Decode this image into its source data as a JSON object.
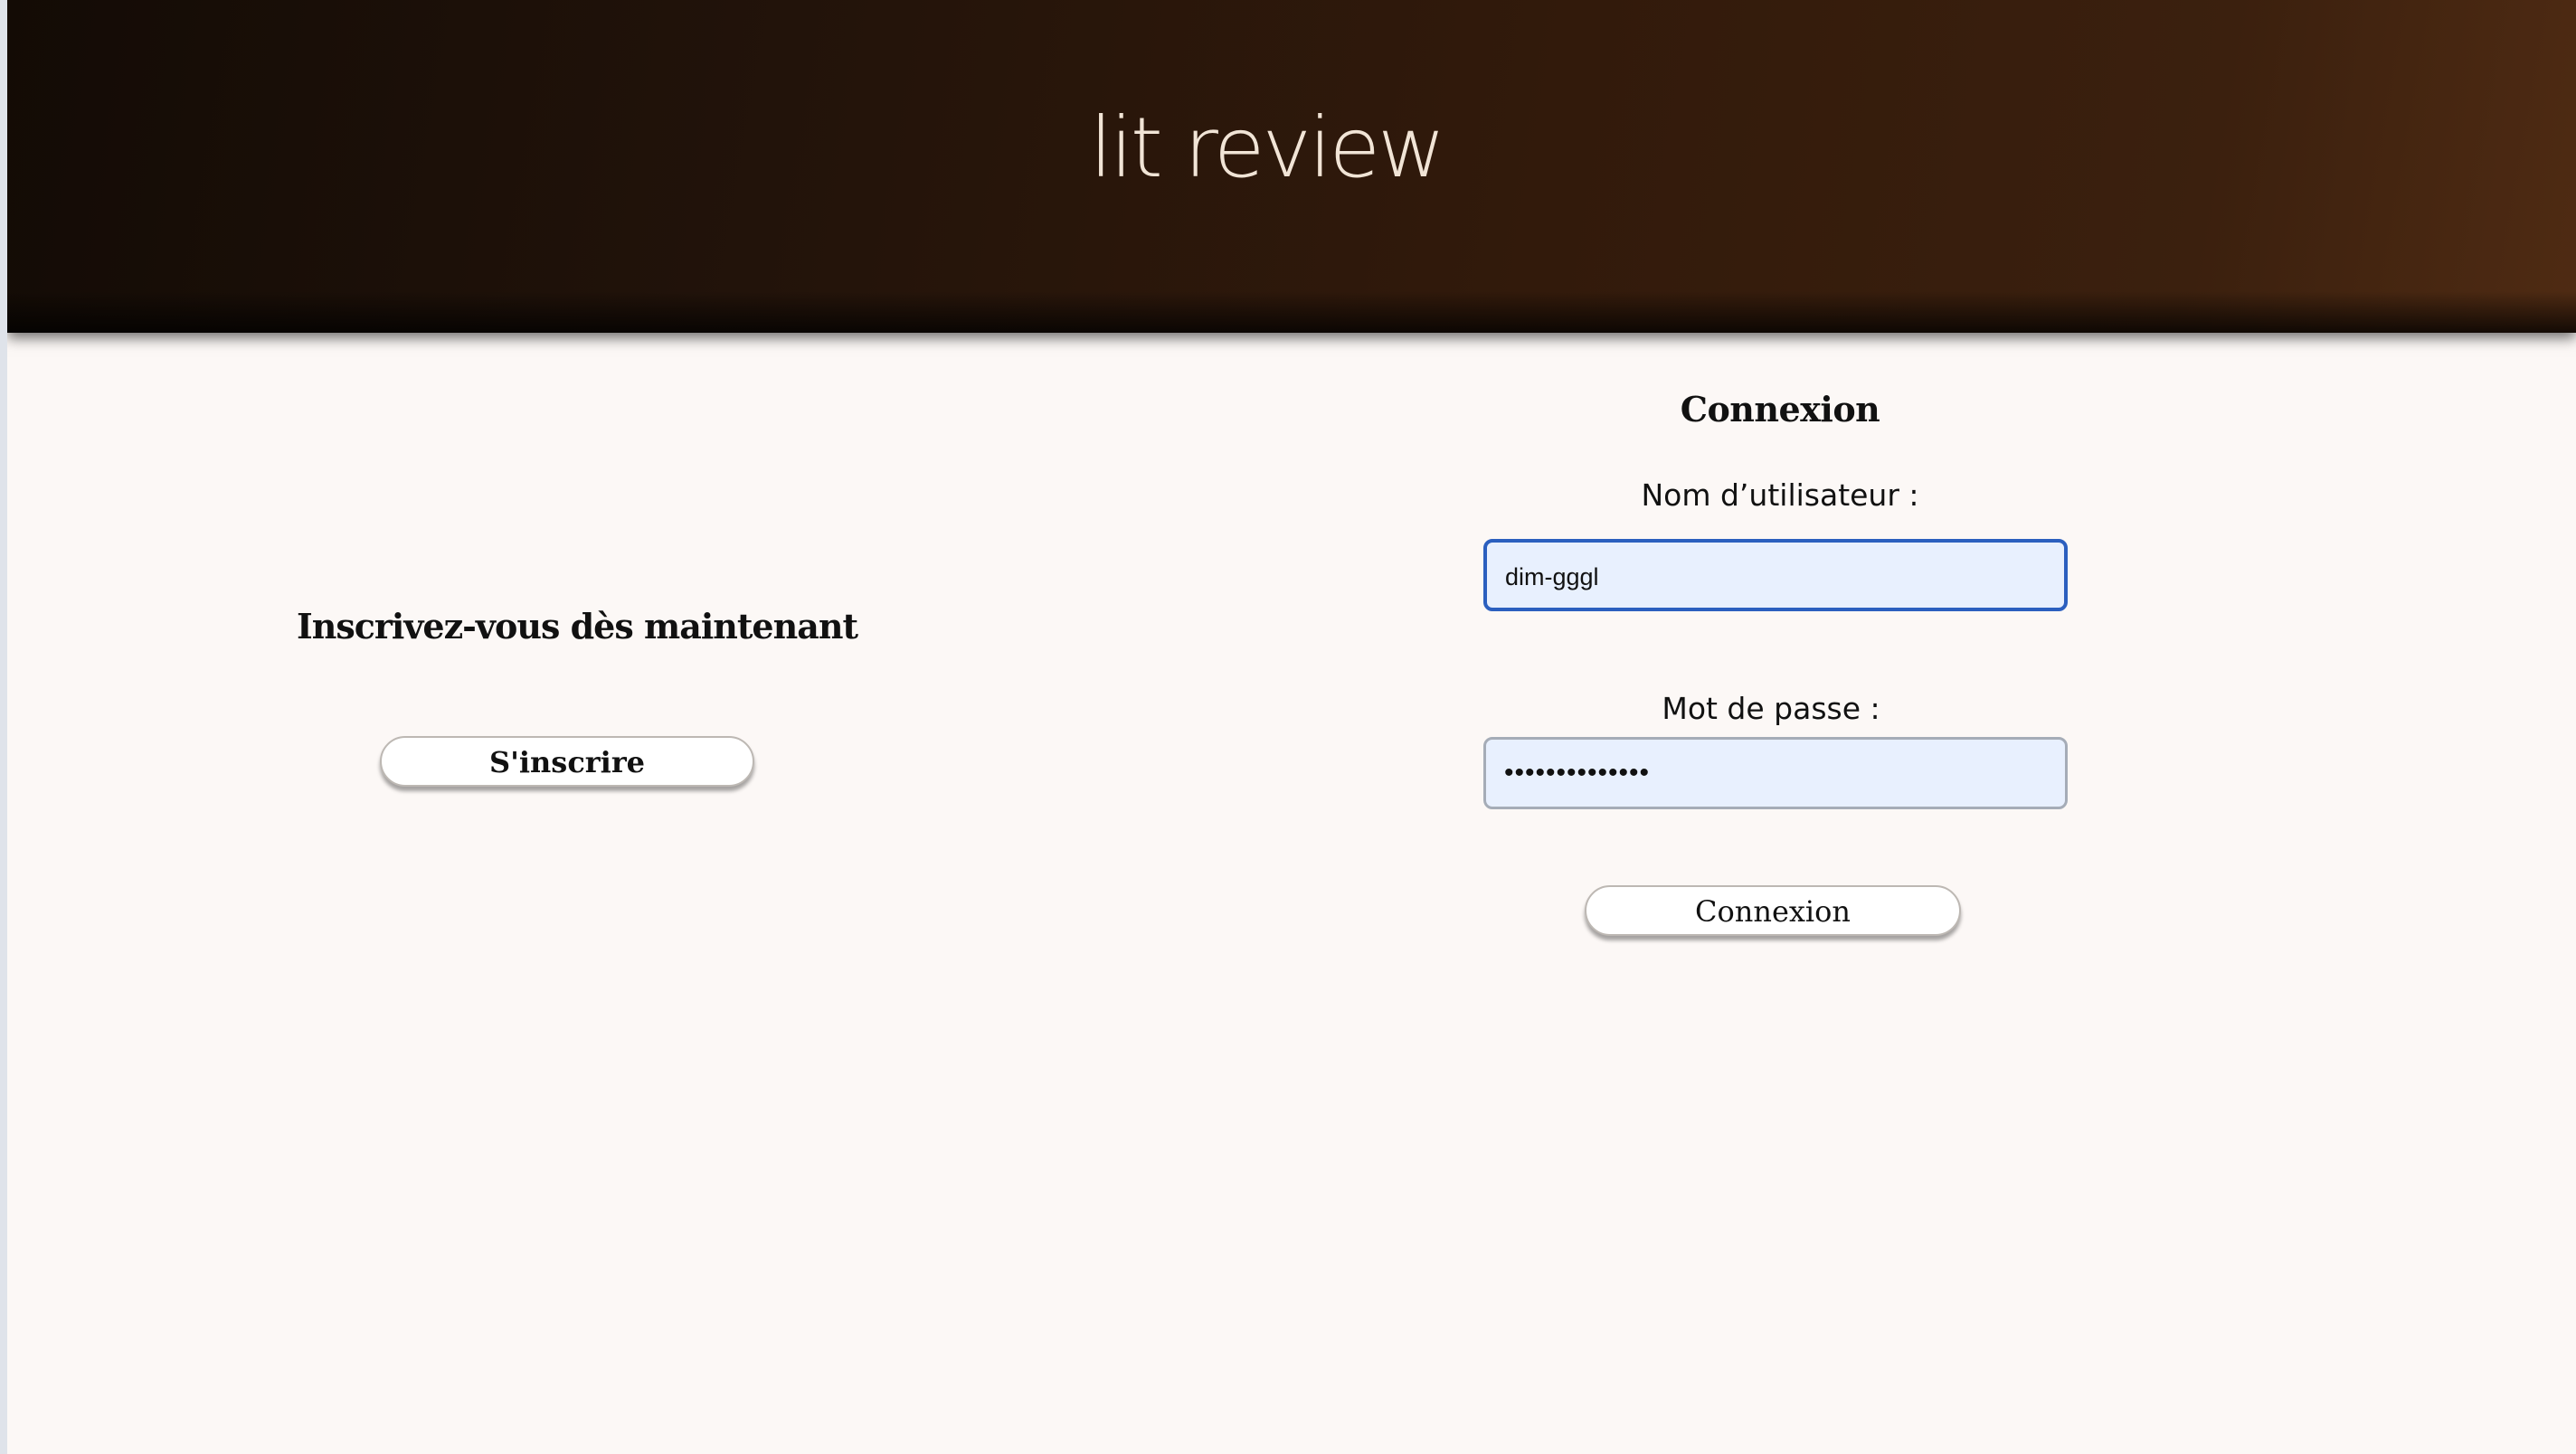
{
  "header": {
    "app_title": "lit review"
  },
  "signup": {
    "heading": "Inscrivez-vous dès maintenant",
    "button_label": "S'inscrire"
  },
  "login": {
    "heading": "Connexion",
    "username_label": "Nom d’utilisateur :",
    "username_value": "dim-gggl",
    "password_label": "Mot de passe :",
    "password_masked_value": "••••••••••••••",
    "button_label": "Connexion"
  },
  "colors": {
    "header_gradient_start": "#130b05",
    "header_gradient_end": "#4f2b13",
    "page_background": "#fcf8f6",
    "input_background": "#e8f0fe",
    "focused_input_border": "#2b5fbf",
    "title_color": "#f1e4d6"
  }
}
